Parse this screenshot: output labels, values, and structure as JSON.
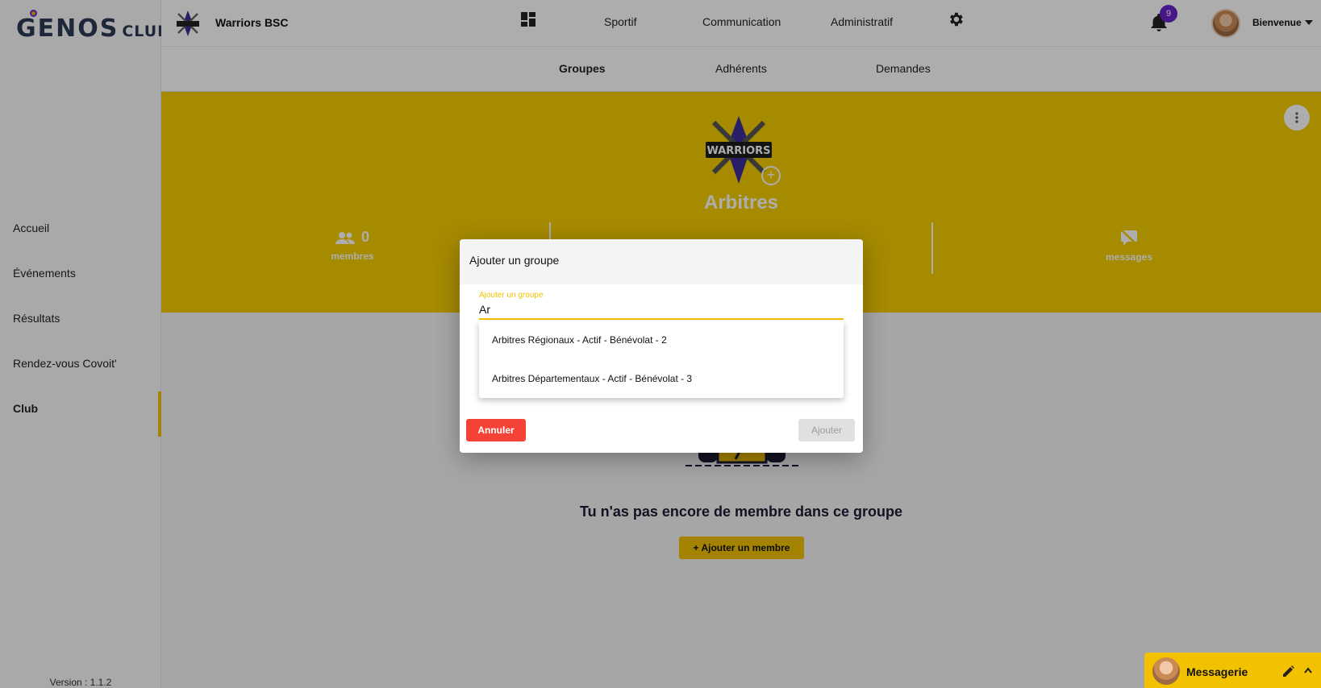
{
  "app": {
    "logo_main": "GENOS",
    "logo_sub": "CLUBS",
    "version": "Version : 1.1.2"
  },
  "sidebar": {
    "items": [
      {
        "label": "Accueil"
      },
      {
        "label": "Événements"
      },
      {
        "label": "Résultats"
      },
      {
        "label": "Rendez-vous Covoit'"
      },
      {
        "label": "Club",
        "active": true
      }
    ]
  },
  "header": {
    "club_name": "Warriors BSC",
    "nav": [
      "Sportif",
      "Communication",
      "Administratif"
    ],
    "notifications": "9",
    "welcome": "Bienvenue",
    "icons": [
      "dashboard-icon",
      "gear-icon",
      "bell-icon",
      "chevron-down-icon"
    ]
  },
  "subnav": {
    "tabs": [
      "Groupes",
      "Adhérents",
      "Demandes"
    ],
    "active": "Groupes"
  },
  "banner": {
    "logo_text": "WARRIORS",
    "group_name": "Arbitres",
    "stats": [
      {
        "value": "0",
        "label": "membres",
        "icon": "people-icon"
      },
      {
        "value": "",
        "label": "messages",
        "icon": "message-off-icon"
      }
    ]
  },
  "empty_state": {
    "text": "Tu n'as pas encore de membre dans ce groupe",
    "button": "Ajouter un membre"
  },
  "messagerie": {
    "label": "Messagerie"
  },
  "modal": {
    "title": "Ajouter un groupe",
    "field_label": "Ajouter un groupe",
    "input_value": "Ar",
    "options": [
      "Arbitres Régionaux - Actif - Bénévolat - 2",
      "Arbitres Départementaux - Actif - Bénévolat - 3"
    ],
    "cancel": "Annuler",
    "submit": "Ajouter"
  },
  "colors": {
    "accent": "#f2c200",
    "danger": "#f44336",
    "badge": "#6b23c8",
    "navy": "#2b3a55"
  }
}
